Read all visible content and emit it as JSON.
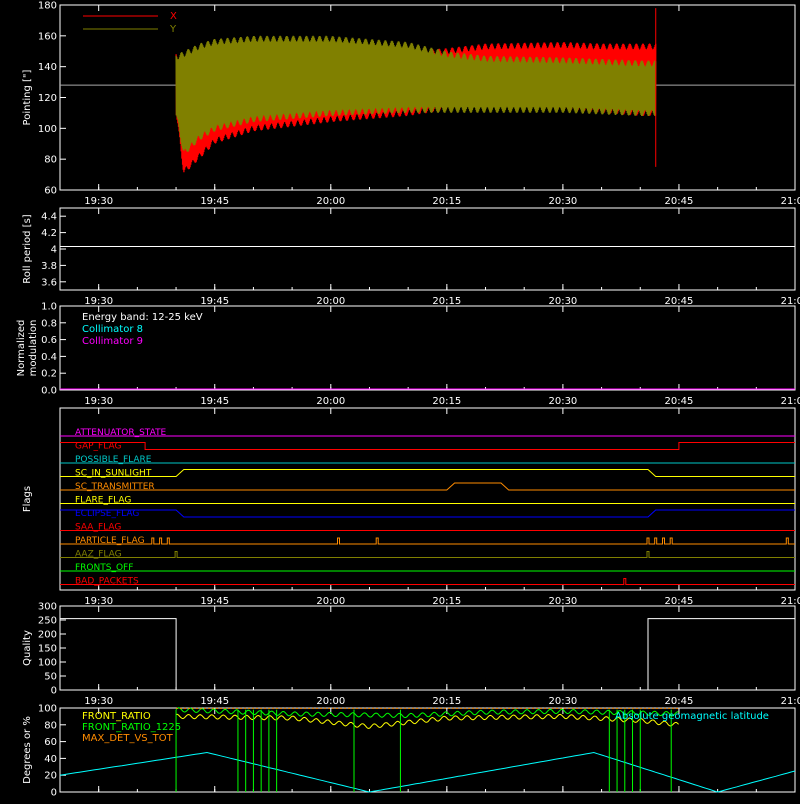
{
  "time_ticks": [
    "19:30",
    "19:45",
    "20:00",
    "20:15",
    "20:30",
    "20:45",
    "21:00"
  ],
  "chart_data": [
    {
      "type": "line",
      "ylabel": "Pointing [\"]",
      "ylim": [
        60,
        180
      ],
      "yticks": [
        60,
        80,
        100,
        120,
        140,
        160,
        180
      ],
      "reference_line": 128,
      "legend": [
        {
          "name": "X",
          "color": "#ff0000"
        },
        {
          "name": "Y",
          "color": "#808000"
        }
      ],
      "data_range_minutes": [
        1180,
        1242
      ],
      "series": [
        {
          "name": "X",
          "color": "#ff0000",
          "envelope": {
            "minutes": [
              1180,
              1181,
              1183,
              1185,
              1190,
              1200,
              1210,
              1215,
              1220,
              1230,
              1235,
              1240,
              1242
            ],
            "upper": [
              148,
              135,
              140,
              144,
              146,
              148,
              150,
              152,
              155,
              156,
              155,
              155,
              155
            ],
            "lower": [
              110,
              70,
              80,
              90,
              98,
              104,
              108,
              112,
              115,
              112,
              110,
              108,
              108
            ]
          }
        },
        {
          "name": "Y",
          "color": "#808000",
          "envelope": {
            "minutes": [
              1180,
              1181,
              1183,
              1185,
              1190,
              1200,
              1210,
              1215,
              1220,
              1230,
              1235,
              1240,
              1242
            ],
            "upper": [
              148,
              150,
              155,
              158,
              160,
              160,
              156,
              150,
              147,
              146,
              145,
              144,
              144
            ],
            "lower": [
              108,
              82,
              92,
              98,
              104,
              108,
              110,
              110,
              110,
              110,
              109,
              108,
              108
            ]
          }
        }
      ]
    },
    {
      "type": "line",
      "ylabel": "Roll period [s]",
      "ylim": [
        3.5,
        4.5
      ],
      "yticks": [
        3.6,
        3.8,
        4.0,
        4.2,
        4.4
      ],
      "series": [
        {
          "name": "",
          "color": "#ffffff",
          "x": [
            1165,
            1260
          ],
          "y": [
            4.03,
            4.03
          ]
        }
      ]
    },
    {
      "type": "line",
      "ylabel": "Normalized modulation",
      "ylim": [
        0,
        1
      ],
      "yticks": [
        0.0,
        0.2,
        0.4,
        0.6,
        0.8,
        1.0
      ],
      "yticks_labels": [
        "0.0",
        "0.2",
        "0.4",
        "0.6",
        "0.8",
        "1.0"
      ],
      "annotations": [
        {
          "text": "Energy band: 12-25 keV",
          "color": "#ffffff"
        },
        {
          "text": "Collimator 8",
          "color": "#00ffff"
        },
        {
          "text": "Collimator 9",
          "color": "#ff00ff"
        }
      ],
      "series": [
        {
          "name": "Collimator 9",
          "color": "#ff00ff",
          "x": [
            1165,
            1260
          ],
          "y": [
            0,
            0
          ]
        }
      ]
    },
    {
      "type": "line",
      "ylabel": "Flags",
      "flags": [
        {
          "name": "ATTENUATOR_STATE",
          "color": "#ff00ff",
          "steps": [
            [
              1165,
              0
            ],
            [
              1260,
              0
            ]
          ]
        },
        {
          "name": "GAP_FLAG",
          "color": "#ff0000",
          "steps": [
            [
              1165,
              1
            ],
            [
              1176,
              1
            ],
            [
              1176,
              0
            ],
            [
              1245,
              0
            ],
            [
              1245,
              1
            ],
            [
              1260,
              1
            ]
          ]
        },
        {
          "name": "POSSIBLE_FLARE",
          "color": "#00c8c8",
          "steps": [
            [
              1165,
              0
            ],
            [
              1260,
              0
            ]
          ]
        },
        {
          "name": "SC_IN_SUNLIGHT",
          "color": "#ffff00",
          "steps": [
            [
              1165,
              0
            ],
            [
              1180,
              0
            ],
            [
              1181,
              1
            ],
            [
              1241,
              1
            ],
            [
              1242,
              0
            ],
            [
              1260,
              0
            ]
          ]
        },
        {
          "name": "SC_TRANSMITTER",
          "color": "#ff8c00",
          "steps": [
            [
              1165,
              0
            ],
            [
              1215,
              0
            ],
            [
              1216,
              1
            ],
            [
              1222,
              1
            ],
            [
              1223,
              0
            ],
            [
              1260,
              0
            ]
          ]
        },
        {
          "name": "FLARE_FLAG",
          "color": "#ffff00",
          "steps": [
            [
              1165,
              0
            ],
            [
              1260,
              0
            ]
          ]
        },
        {
          "name": "ECLIPSE_FLAG",
          "color": "#0000ff",
          "steps": [
            [
              1165,
              1
            ],
            [
              1180,
              1
            ],
            [
              1181,
              0
            ],
            [
              1241,
              0
            ],
            [
              1242,
              1
            ],
            [
              1260,
              1
            ]
          ]
        },
        {
          "name": "SAA_FLAG",
          "color": "#ff0000",
          "steps": [
            [
              1165,
              0
            ],
            [
              1260,
              0
            ]
          ]
        },
        {
          "name": "PARTICLE_FLAG",
          "color": "#ff8c00",
          "spikes": [
            1177,
            1178,
            1179,
            1201,
            1206,
            1241,
            1242,
            1243,
            1244,
            1259
          ]
        },
        {
          "name": "AAZ_FLAG",
          "color": "#808000",
          "spikes": [
            1180,
            1241
          ]
        },
        {
          "name": "FRONTS_OFF",
          "color": "#00ff00",
          "steps": [
            [
              1165,
              0
            ],
            [
              1260,
              0
            ]
          ]
        },
        {
          "name": "BAD_PACKETS",
          "color": "#ff0000",
          "spikes": [
            1238
          ]
        }
      ]
    },
    {
      "type": "line",
      "ylabel": "Quality",
      "ylim": [
        0,
        300
      ],
      "yticks": [
        0,
        50,
        100,
        150,
        200,
        250,
        300
      ],
      "series": [
        {
          "name": "",
          "color": "#ffffff",
          "x": [
            1165,
            1180,
            1180,
            1241,
            1241,
            1260
          ],
          "y": [
            255,
            255,
            0,
            0,
            255,
            255
          ]
        }
      ]
    },
    {
      "type": "line",
      "ylabel": "Degrees or %",
      "ylim": [
        0,
        100
      ],
      "yticks": [
        0,
        20,
        40,
        60,
        80,
        100
      ],
      "legend": [
        {
          "name": "FRONT_RATIO",
          "color": "#ffff00"
        },
        {
          "name": "FRONT_RATIO_1225",
          "color": "#00ff00"
        },
        {
          "name": "MAX_DET_VS_TOT",
          "color": "#ff8c00"
        },
        {
          "name": "Absolute geomagnetic latitude",
          "color": "#00ffff"
        }
      ],
      "series": [
        {
          "name": "Absolute geomagnetic latitude",
          "color": "#00ffff",
          "x": [
            1165,
            1184,
            1205,
            1234,
            1250,
            1260
          ],
          "y": [
            20,
            47,
            0,
            47,
            0,
            25
          ]
        },
        {
          "name": "FRONT_RATIO",
          "color": "#ffff00",
          "x": [
            1180,
            1195,
            1205,
            1215,
            1230,
            1240,
            1245
          ],
          "y": [
            90,
            88,
            78,
            88,
            90,
            85,
            80
          ]
        },
        {
          "name": "FRONT_RATIO_1225",
          "color": "#00ff00",
          "x": [
            1180,
            1195,
            1210,
            1220,
            1230,
            1245
          ],
          "y": [
            98,
            93,
            91,
            95,
            96,
            93
          ]
        }
      ],
      "dropouts_minutes": [
        1180,
        1188,
        1189,
        1190,
        1191,
        1192,
        1193,
        1203,
        1209,
        1236,
        1237,
        1238,
        1239,
        1240,
        1244
      ]
    }
  ]
}
